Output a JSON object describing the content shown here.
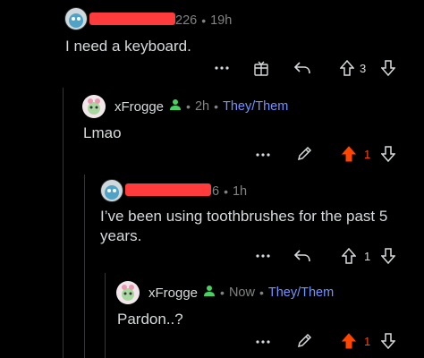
{
  "comments": [
    {
      "id": "c1",
      "user_suffix": "226",
      "age": "19h",
      "body": "I need a keyboard.",
      "score": "3"
    },
    {
      "id": "c2",
      "user": "xFrogge",
      "age": "2h",
      "pronouns": "They/Them",
      "body": "Lmao",
      "score": "1"
    },
    {
      "id": "c3",
      "user_suffix": "6",
      "age": "1h",
      "body_line1": "I’ve been using toothbrushes for the past 5",
      "body_line2": "years.",
      "score": "1"
    },
    {
      "id": "c4",
      "user": "xFrogge",
      "age": "Now",
      "pronouns": "They/Them",
      "body": "Pardon..?",
      "score": "1"
    }
  ],
  "labels": {
    "dot": "•",
    "more": "•••"
  },
  "icons": [
    "more-icon",
    "award-icon",
    "reply-icon",
    "upvote-icon",
    "downvote-icon",
    "edit-icon",
    "person-icon"
  ],
  "colors": {
    "upvote_active": "#ff4500",
    "pronouns": "#7193ff",
    "online": "#46d160",
    "redaction": "#ff3b3b"
  }
}
